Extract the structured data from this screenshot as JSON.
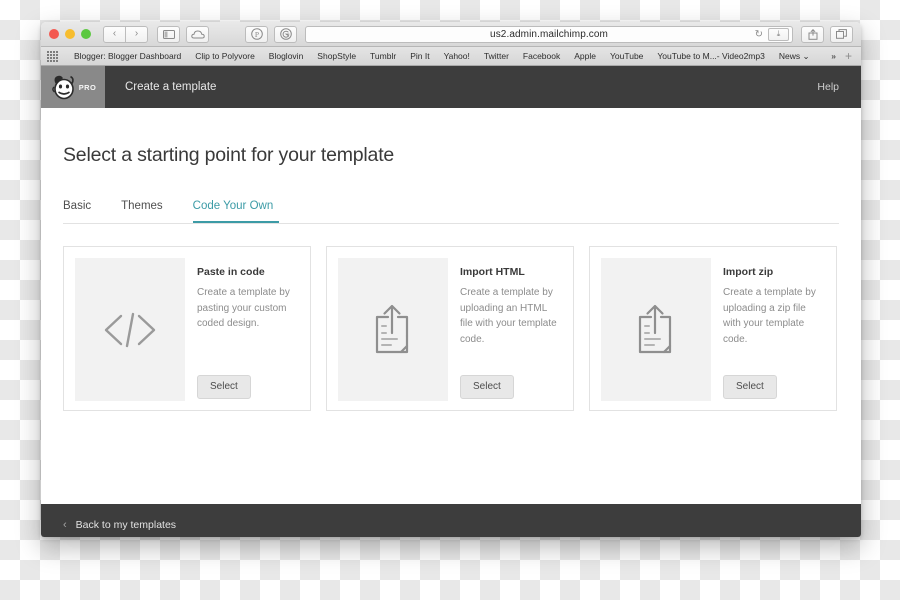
{
  "browser": {
    "traffic_lights": [
      "close",
      "minimize",
      "zoom"
    ],
    "nav": {
      "back": "‹",
      "forward": "›"
    },
    "sidebar_icon": "sidebar-icon",
    "cloud_icon": "cloud-icon",
    "extensions": [
      "pinterest-icon",
      "grammarly-icon"
    ],
    "url": "us2.admin.mailchimp.com",
    "reload_glyph": "↻",
    "reader_glyph": "⤓",
    "share_icon": "share-icon",
    "tabs_icon": "tabs-overview-icon"
  },
  "bookmarks": {
    "apps_icon": "apps-grid-icon",
    "items": [
      "Blogger: Blogger Dashboard",
      "Clip to Polyvore",
      "Bloglovin",
      "ShopStyle",
      "Tumblr",
      "Pin It",
      "Yahoo!",
      "Twitter",
      "Facebook",
      "Apple",
      "YouTube",
      "YouTube to M...- Video2mp3",
      "News ⌄"
    ],
    "overflow": "»",
    "add": "+"
  },
  "app_header": {
    "logo_name": "mailchimp-logo",
    "pro_badge": "PRO",
    "title": "Create a template",
    "help_label": "Help"
  },
  "page": {
    "title": "Select a starting point for your template",
    "tabs": [
      {
        "label": "Basic",
        "active": false
      },
      {
        "label": "Themes",
        "active": false
      },
      {
        "label": "Code Your Own",
        "active": true
      }
    ],
    "cards": [
      {
        "icon": "code-brackets-icon",
        "title": "Paste in code",
        "description": "Create a template by pasting your custom coded design.",
        "button": "Select"
      },
      {
        "icon": "upload-document-icon",
        "title": "Import HTML",
        "description": "Create a template by uploading an HTML file with your template code.",
        "button": "Select"
      },
      {
        "icon": "upload-document-icon",
        "title": "Import zip",
        "description": "Create a template by uploading a zip file with your template code.",
        "button": "Select"
      }
    ]
  },
  "footer": {
    "chevron": "‹",
    "back_label": "Back to my templates"
  },
  "colors": {
    "accent_teal": "#3c9ba6",
    "header_dark": "#3d3d3d",
    "logo_cell": "#898989",
    "thumb_bg": "#f2f2f2",
    "button_bg": "#e8e8e8"
  }
}
